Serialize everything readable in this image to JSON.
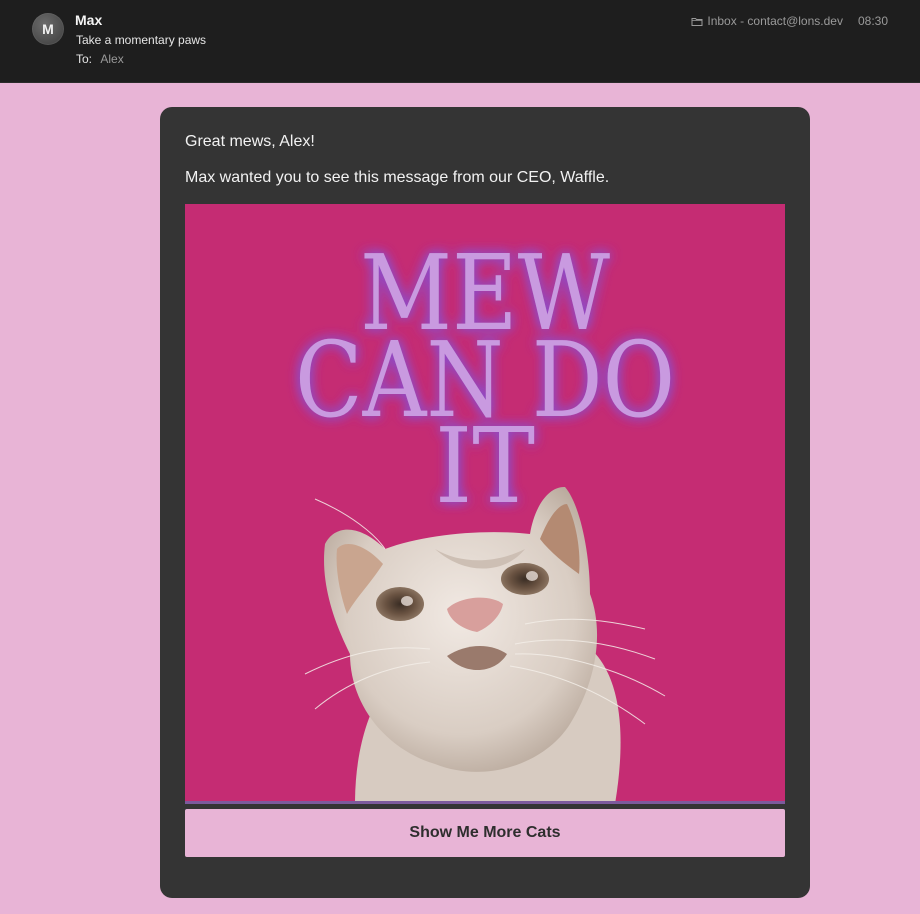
{
  "header": {
    "avatar_initial": "M",
    "sender": "Max",
    "subject": "Take a momentary paws",
    "to_label": "To:",
    "to_value": "Alex",
    "mailbox": "Inbox - contact@lons.dev",
    "time": "08:30",
    "mailbox_icon": "mailbox-icon"
  },
  "email": {
    "greeting": "Great mews, Alex!",
    "intro": "Max wanted you to see this message from our CEO, Waffle.",
    "hero": {
      "line1": "MEW",
      "line2": "CAN DO",
      "line3": "IT"
    },
    "cta_label": "Show Me More Cats"
  },
  "colors": {
    "page_background": "#e8b4d6",
    "header_background": "#1e1e1e",
    "card_background": "#343434",
    "hero_background": "#c52c73",
    "hero_text": "#c99ae0",
    "button_background": "#e8b4d6"
  }
}
